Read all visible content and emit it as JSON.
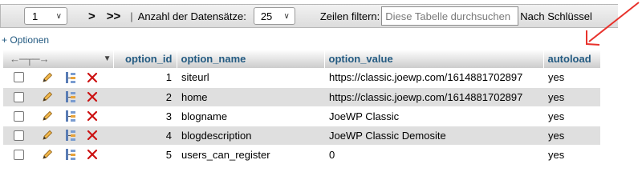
{
  "toolbar": {
    "page_value": "1",
    "next_label": ">",
    "last_label": ">>",
    "separator": "|",
    "count_label": "Anzahl der Datensätze:",
    "count_value": "25",
    "filter_label": "Zeilen filtern:",
    "filter_placeholder": "Diese Tabelle durchsuchen",
    "sort_label": "Nach Schlüssel"
  },
  "options_link": "+ Optionen",
  "table": {
    "columns": [
      "option_id",
      "option_name",
      "option_value",
      "autoload"
    ],
    "rows": [
      {
        "option_id": "1",
        "option_name": "siteurl",
        "option_value": "https://classic.joewp.com/1614881702897",
        "autoload": "yes"
      },
      {
        "option_id": "2",
        "option_name": "home",
        "option_value": "https://classic.joewp.com/1614881702897",
        "autoload": "yes"
      },
      {
        "option_id": "3",
        "option_name": "blogname",
        "option_value": "JoeWP Classic",
        "autoload": "yes"
      },
      {
        "option_id": "4",
        "option_name": "blogdescription",
        "option_value": "JoeWP Classic Demosite",
        "autoload": "yes"
      },
      {
        "option_id": "5",
        "option_name": "users_can_register",
        "option_value": "0",
        "autoload": "yes"
      }
    ]
  },
  "colors": {
    "header_text": "#235a81",
    "row_even": "#dfdfdf",
    "annotation_arrow": "#e8322c",
    "delete_icon": "#cc1111"
  },
  "icons": {
    "edit": "pencil-icon",
    "copy": "copy-icon",
    "delete": "delete-x-icon",
    "sort_arrows": "left-right-arrows-icon"
  }
}
